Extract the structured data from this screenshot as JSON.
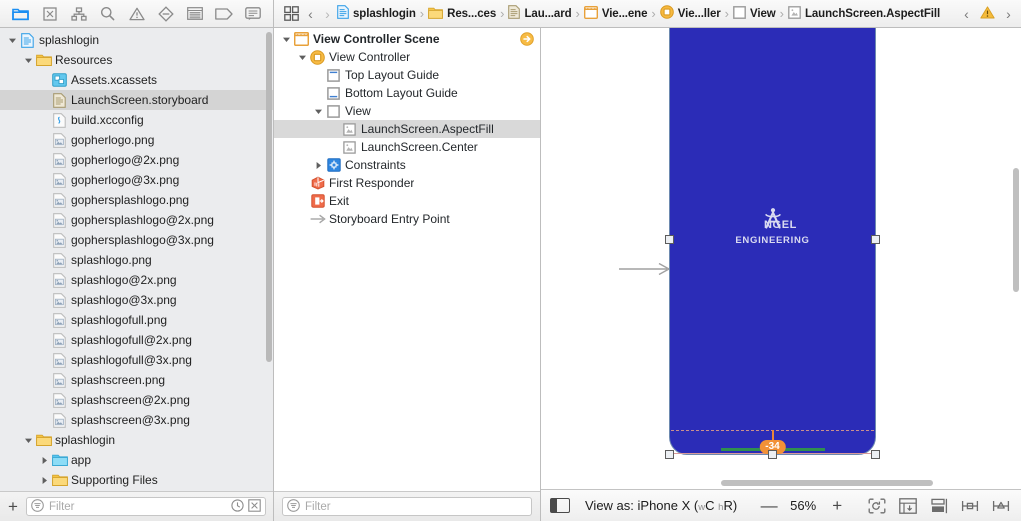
{
  "navigator_toolbar": {
    "icons": [
      {
        "name": "folder-icon",
        "label": "Project navigator",
        "active": true
      },
      {
        "name": "source-control-icon",
        "label": "Source control navigator",
        "active": false
      },
      {
        "name": "symbol-hierarchy-icon",
        "label": "Symbol navigator",
        "active": false
      },
      {
        "name": "search-icon",
        "label": "Find navigator",
        "active": false
      },
      {
        "name": "warning-triangle-icon",
        "label": "Issue navigator",
        "active": false
      },
      {
        "name": "test-diamond-icon",
        "label": "Test navigator",
        "active": false
      },
      {
        "name": "debug-list-icon",
        "label": "Debug navigator",
        "active": false
      },
      {
        "name": "breakpoint-tag-icon",
        "label": "Breakpoint navigator",
        "active": false
      },
      {
        "name": "report-message-icon",
        "label": "Report navigator",
        "active": false
      }
    ]
  },
  "navigator": {
    "items": [
      {
        "label": "splashlogin",
        "depth": 0,
        "icon": "project-icon",
        "twisty": "down",
        "selected": false
      },
      {
        "label": "Resources",
        "depth": 1,
        "icon": "folder-icon",
        "twisty": "down",
        "selected": false
      },
      {
        "label": "Assets.xcassets",
        "depth": 2,
        "icon": "assets-icon",
        "twisty": "none",
        "selected": false
      },
      {
        "label": "LaunchScreen.storyboard",
        "depth": 2,
        "icon": "storyboard-icon",
        "twisty": "none",
        "selected": true
      },
      {
        "label": "build.xcconfig",
        "depth": 2,
        "icon": "config-icon",
        "twisty": "none",
        "selected": false
      },
      {
        "label": "gopherlogo.png",
        "depth": 2,
        "icon": "image-icon",
        "twisty": "none",
        "selected": false
      },
      {
        "label": "gopherlogo@2x.png",
        "depth": 2,
        "icon": "image-icon",
        "twisty": "none",
        "selected": false
      },
      {
        "label": "gopherlogo@3x.png",
        "depth": 2,
        "icon": "image-icon",
        "twisty": "none",
        "selected": false
      },
      {
        "label": "gophersplashlogo.png",
        "depth": 2,
        "icon": "image-icon",
        "twisty": "none",
        "selected": false
      },
      {
        "label": "gophersplashlogo@2x.png",
        "depth": 2,
        "icon": "image-icon",
        "twisty": "none",
        "selected": false
      },
      {
        "label": "gophersplashlogo@3x.png",
        "depth": 2,
        "icon": "image-icon",
        "twisty": "none",
        "selected": false
      },
      {
        "label": "splashlogo.png",
        "depth": 2,
        "icon": "image-icon",
        "twisty": "none",
        "selected": false
      },
      {
        "label": "splashlogo@2x.png",
        "depth": 2,
        "icon": "image-icon",
        "twisty": "none",
        "selected": false
      },
      {
        "label": "splashlogo@3x.png",
        "depth": 2,
        "icon": "image-icon",
        "twisty": "none",
        "selected": false
      },
      {
        "label": "splashlogofull.png",
        "depth": 2,
        "icon": "image-icon",
        "twisty": "none",
        "selected": false
      },
      {
        "label": "splashlogofull@2x.png",
        "depth": 2,
        "icon": "image-icon",
        "twisty": "none",
        "selected": false
      },
      {
        "label": "splashlogofull@3x.png",
        "depth": 2,
        "icon": "image-icon",
        "twisty": "none",
        "selected": false
      },
      {
        "label": "splashscreen.png",
        "depth": 2,
        "icon": "image-icon",
        "twisty": "none",
        "selected": false
      },
      {
        "label": "splashscreen@2x.png",
        "depth": 2,
        "icon": "image-icon",
        "twisty": "none",
        "selected": false
      },
      {
        "label": "splashscreen@3x.png",
        "depth": 2,
        "icon": "image-icon",
        "twisty": "none",
        "selected": false
      },
      {
        "label": "splashlogin",
        "depth": 1,
        "icon": "folder-icon",
        "twisty": "down",
        "selected": false
      },
      {
        "label": "app",
        "depth": 2,
        "icon": "folder-blue-icon",
        "twisty": "right",
        "selected": false
      },
      {
        "label": "Supporting Files",
        "depth": 2,
        "icon": "folder-icon",
        "twisty": "right",
        "selected": false
      }
    ],
    "filter_placeholder": "Filter",
    "add_button_label": "+",
    "filter_left_icon": "filter-circle-icon",
    "filter_right_icons": [
      "recent-clock-icon",
      "source-control-status-icon"
    ]
  },
  "jumpbar": {
    "grid_icon": "related-items-icon",
    "back_arrow": "‹",
    "forward_arrow": "›",
    "crumbs": [
      {
        "label": "splashlogin",
        "icon": "project-icon"
      },
      {
        "label": "Res...ces",
        "icon": "folder-icon"
      },
      {
        "label": "Lau...ard",
        "icon": "storyboard-icon"
      },
      {
        "label": "Vie...ene",
        "icon": "scene-icon"
      },
      {
        "label": "Vie...ller",
        "icon": "viewcontroller-icon"
      },
      {
        "label": "View",
        "icon": "view-icon"
      },
      {
        "label": "LaunchScreen.AspectFill",
        "icon": "imageview-icon"
      }
    ],
    "right_controls": {
      "prev_issue": "‹",
      "warning_icon": "warning-triangle-icon",
      "next_issue": "›"
    }
  },
  "outline": {
    "items": [
      {
        "label": "View Controller Scene",
        "depth": 0,
        "icon": "scene-icon",
        "twisty": "down",
        "selected": false,
        "bold": true,
        "entry_arrow": true
      },
      {
        "label": "View Controller",
        "depth": 1,
        "icon": "viewcontroller-icon",
        "twisty": "down",
        "selected": false,
        "bold": false,
        "entry_arrow": false
      },
      {
        "label": "Top Layout Guide",
        "depth": 2,
        "icon": "top-layout-guide-icon",
        "twisty": "none",
        "selected": false,
        "bold": false,
        "entry_arrow": false
      },
      {
        "label": "Bottom Layout Guide",
        "depth": 2,
        "icon": "bottom-layout-guide-icon",
        "twisty": "none",
        "selected": false,
        "bold": false,
        "entry_arrow": false
      },
      {
        "label": "View",
        "depth": 2,
        "icon": "view-icon",
        "twisty": "down",
        "selected": false,
        "bold": false,
        "entry_arrow": false
      },
      {
        "label": "LaunchScreen.AspectFill",
        "depth": 3,
        "icon": "imageview-icon",
        "twisty": "none",
        "selected": true,
        "bold": false,
        "entry_arrow": false
      },
      {
        "label": "LaunchScreen.Center",
        "depth": 3,
        "icon": "imageview-icon",
        "twisty": "none",
        "selected": false,
        "bold": false,
        "entry_arrow": false
      },
      {
        "label": "Constraints",
        "depth": 2,
        "icon": "constraints-icon",
        "twisty": "right",
        "selected": false,
        "bold": false,
        "entry_arrow": false
      },
      {
        "label": "First Responder",
        "depth": 1,
        "icon": "first-responder-icon",
        "twisty": "none",
        "selected": false,
        "bold": false,
        "entry_arrow": false
      },
      {
        "label": "Exit",
        "depth": 1,
        "icon": "exit-icon",
        "twisty": "none",
        "selected": false,
        "bold": false,
        "entry_arrow": false
      },
      {
        "label": "Storyboard Entry Point",
        "depth": 1,
        "icon": "entry-point-arrow-icon",
        "twisty": "none",
        "selected": false,
        "bold": false,
        "entry_arrow": false
      }
    ],
    "filter_placeholder": "Filter",
    "filter_left_icon": "filter-circle-icon"
  },
  "canvas": {
    "device_background_color": "#2b2cb7",
    "logo": {
      "mark": "angel-compass-icon",
      "word_first_letter": "A",
      "word_rest": "NGEL",
      "subtitle": "ENGINEERING"
    },
    "constraint_badge": "-34",
    "entry_point_arrow": "storyboard-entry-arrow-icon"
  },
  "statusbar": {
    "panel_toggle_icon": "document-outline-toggle-icon",
    "view_as_prefix": "View as: ",
    "view_as_device": "iPhone X",
    "view_as_traits_open": "(",
    "view_as_w": "w",
    "view_as_wclass": "C",
    "view_as_h": "h",
    "view_as_hclass": "R",
    "view_as_traits_close": ")",
    "zoom_out_label": "—",
    "zoom_value": "56%",
    "zoom_in_label": "+",
    "right_icons": [
      {
        "name": "update-frames-icon",
        "label": "Update frames"
      },
      {
        "name": "embed-in-icon",
        "label": "Embed in"
      },
      {
        "name": "align-icon",
        "label": "Align"
      },
      {
        "name": "pin-icon",
        "label": "Add new constraints"
      },
      {
        "name": "resolve-issues-icon",
        "label": "Resolve auto layout issues"
      }
    ]
  }
}
